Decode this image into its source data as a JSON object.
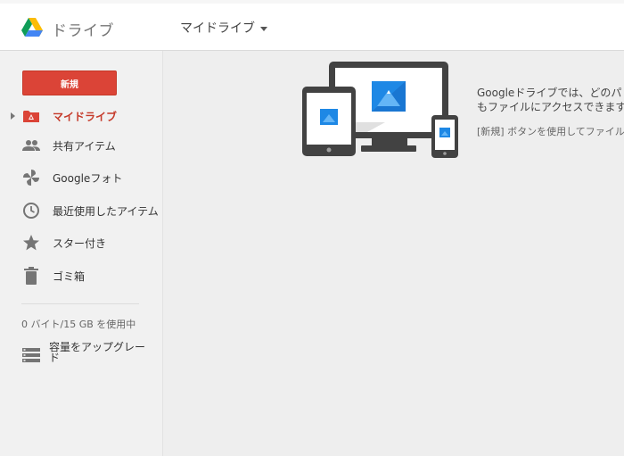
{
  "header": {
    "app_name": "ドライブ",
    "breadcrumb": "マイドライブ"
  },
  "sidebar": {
    "new_button": "新規",
    "items": [
      {
        "label": "マイドライブ",
        "icon": "drive-folder-icon",
        "active": true
      },
      {
        "label": "共有アイテム",
        "icon": "people-icon"
      },
      {
        "label": "Googleフォト",
        "icon": "photos-pinwheel-icon"
      },
      {
        "label": "最近使用したアイテム",
        "icon": "clock-icon"
      },
      {
        "label": "スター付き",
        "icon": "star-icon"
      },
      {
        "label": "ゴミ箱",
        "icon": "trash-icon"
      }
    ],
    "storage": "0 バイト/15 GB を使用中",
    "upgrade": "容量をアップグレード"
  },
  "main": {
    "empty_line1": "Googleドライブでは、どのパ",
    "empty_line2": "もファイルにアクセスできます",
    "empty_line3": "[新規] ボタンを使用してファイルを"
  },
  "colors": {
    "accent_red": "#db4437",
    "active_text": "#c53929",
    "device_gray": "#424242",
    "photo_blue": "#1e88e5"
  }
}
